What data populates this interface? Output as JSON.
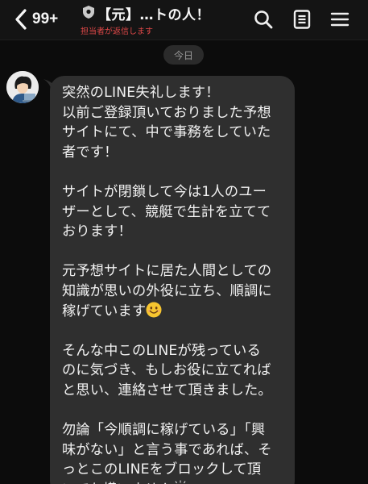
{
  "header": {
    "unread_count": "99+",
    "title": "【元】…トの人！",
    "subtitle": "担当者が返信します"
  },
  "date_separator": "今日",
  "message": {
    "paragraphs": [
      "突然のLINE失礼します！\n以前ご登録頂いておりました予想\nサイトにて、中で事務をしていた\n者です！",
      "サイトが閉鎖して今は1人のユー\nザーとして、競艇で生計を立てて\nおります！",
      "元予想サイトに居た人間としての\n知識が思いの外役に立ち、順調に\n稼げています",
      "そんな中このLINEが残っている\nのに気づき、もしお役に立てれば\nと思い、連絡させて頂きました。",
      "勿論「今順調に稼げている」「興\n味がない」と言う事であれば、そ\nっとこのLINEをブロックして頂\nいても構いません"
    ]
  },
  "icons": [
    "chevron-left-icon",
    "shield-icon",
    "search-icon",
    "notes-icon",
    "menu-icon",
    "smile-emoji",
    "bowing-emoji"
  ],
  "colors": {
    "background": "#0c0c0c",
    "header_bg": "#141414",
    "bubble_bg": "#2f2f2f",
    "subtitle_red": "#e04848",
    "text": "#f2f2f2"
  }
}
